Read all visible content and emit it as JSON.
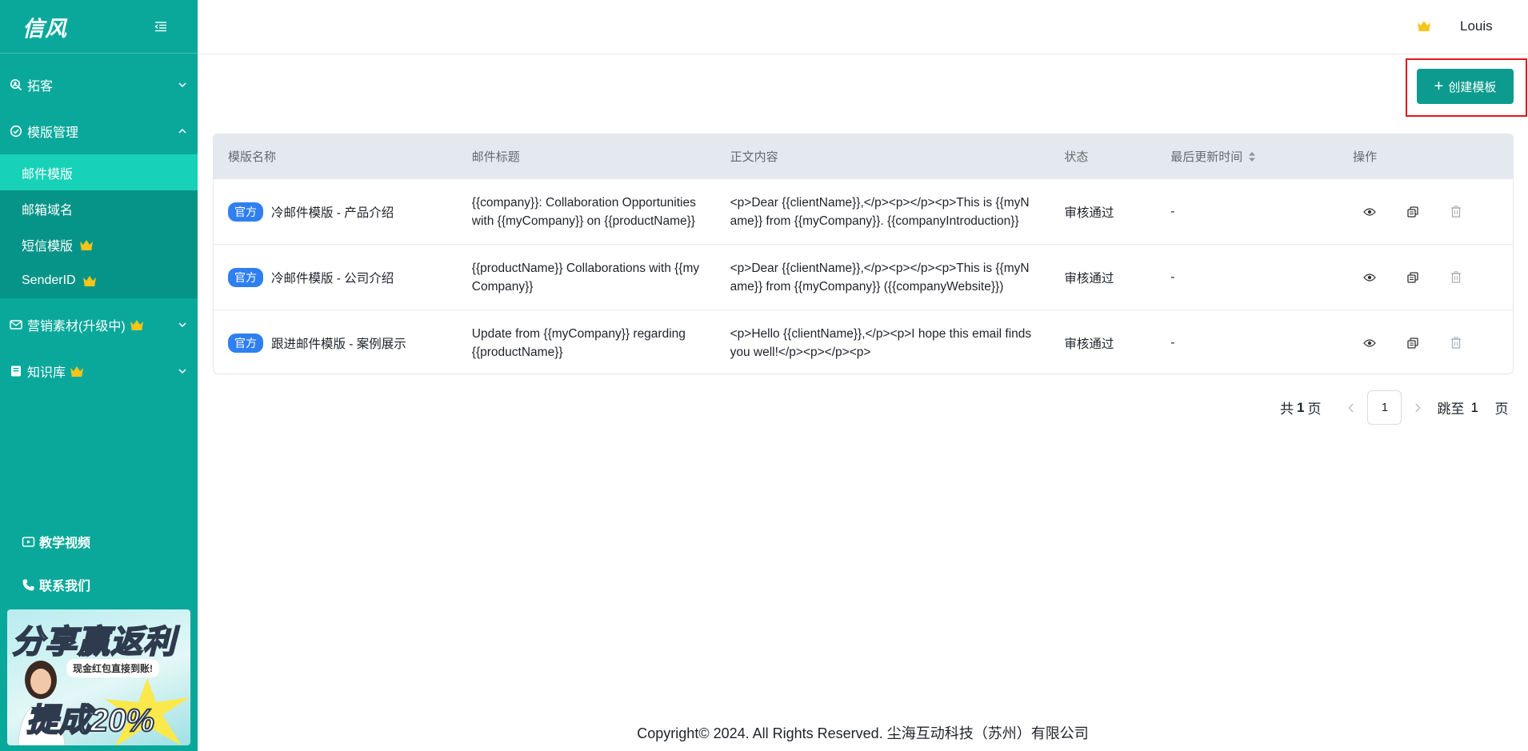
{
  "sidebar": {
    "logo": "信风",
    "groups": [
      {
        "label": "拓客"
      },
      {
        "label": "模版管理"
      },
      {
        "label": "营销素材(升级中)"
      },
      {
        "label": "知识库"
      }
    ],
    "sub_items": [
      {
        "label": "邮件模版"
      },
      {
        "label": "邮箱域名"
      },
      {
        "label": "短信模版"
      },
      {
        "label": "SenderID"
      }
    ],
    "bottom_links": [
      {
        "label": "教学视频"
      },
      {
        "label": "联系我们"
      }
    ],
    "promo": {
      "title": "分享赢返利",
      "subtitle": "现金红包直接到账!",
      "rate": "提成20%"
    }
  },
  "header": {
    "user_name": "Louis"
  },
  "toolbar": {
    "create_label": "创建模板"
  },
  "table": {
    "columns": [
      "模版名称",
      "邮件标题",
      "正文内容",
      "状态",
      "最后更新时间",
      "操作"
    ],
    "rows": [
      {
        "tag": "官方",
        "name": "冷邮件模版 - 产品介绍",
        "subject": "{{company}}: Collaboration Opportunities with {{myCompany}} on {{productName}}",
        "body": "<p>Dear {{clientName}},</p><p></p><p>This is {{myName}} from {{myCompany}}. {{companyIntroduction}}",
        "status": "审核通过",
        "updated": "-"
      },
      {
        "tag": "官方",
        "name": "冷邮件模版 - 公司介绍",
        "subject": "{{productName}} Collaborations with {{myCompany}}",
        "body": "<p>Dear {{clientName}},</p><p></p><p>This is {{myName}} from {{myCompany}} ({{companyWebsite}})",
        "status": "审核通过",
        "updated": "-"
      },
      {
        "tag": "官方",
        "name": "跟进邮件模版 - 案例展示",
        "subject": "Update from {{myCompany}} regarding {{productName}}",
        "body": "<p>Hello {{clientName}},</p><p>I hope this email finds you well!</p><p></p><p>",
        "status": "审核通过",
        "updated": "-"
      }
    ]
  },
  "pagination": {
    "total_prefix": "共",
    "total_pages": "1",
    "total_suffix": "页",
    "current": "1",
    "jump_label": "跳至",
    "jump_value": "1",
    "jump_suffix": "页"
  },
  "footer": {
    "copyright": "Copyright© 2024. All Rights Reserved. 尘海互动科技（苏州）有限公司"
  },
  "colors": {
    "sidebar": "#09a89b",
    "active_item": "#17d1b8",
    "primary": "#0c9b8e",
    "tag": "#2f7ff0",
    "crown": "#f5c518",
    "highlight": "#e4161c"
  }
}
